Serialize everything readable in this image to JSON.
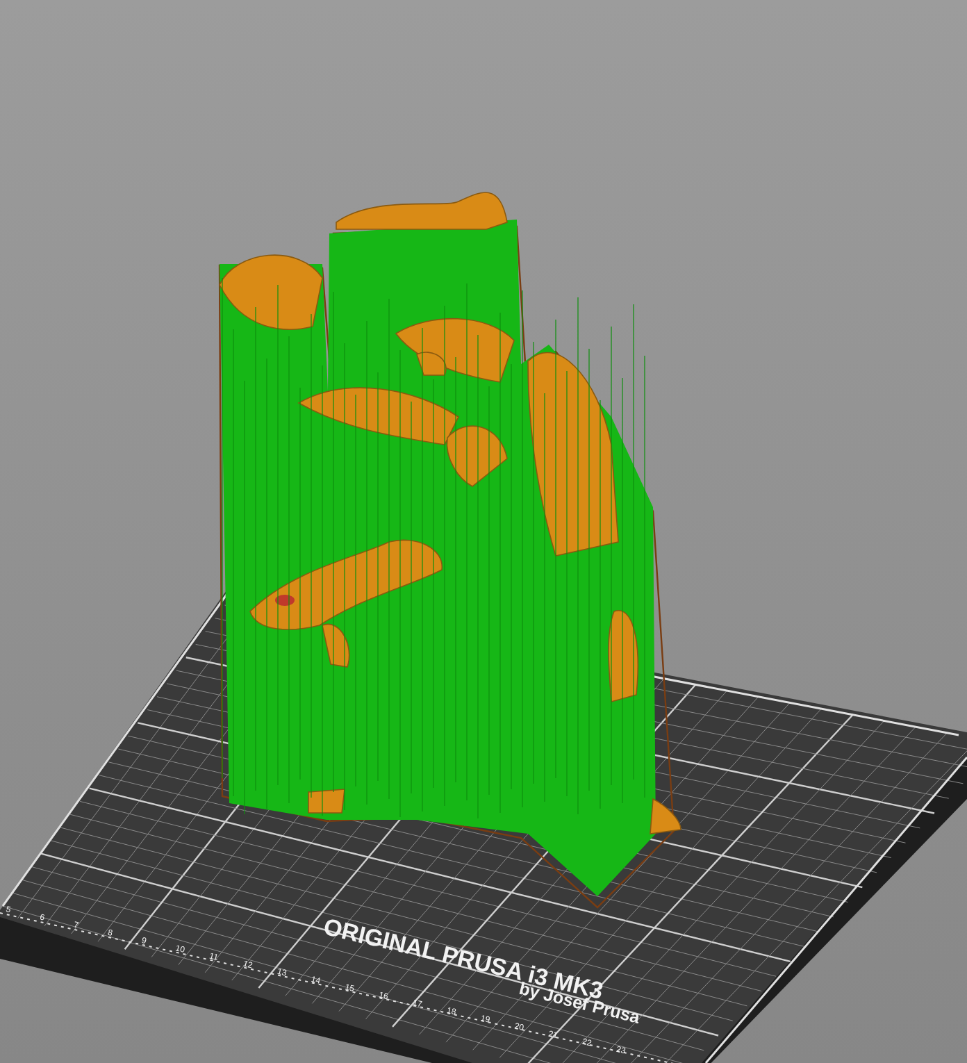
{
  "viewport": {
    "bed": {
      "logo_title": "ORIGINAL PRUSA i3 MK3",
      "logo_subtitle": "by Josef Prusa",
      "ruler_labels": [
        "5",
        "6",
        "7",
        "8",
        "9",
        "10",
        "11",
        "12",
        "13",
        "14",
        "15",
        "16",
        "17",
        "18",
        "19",
        "20",
        "21",
        "22",
        "23"
      ]
    }
  }
}
